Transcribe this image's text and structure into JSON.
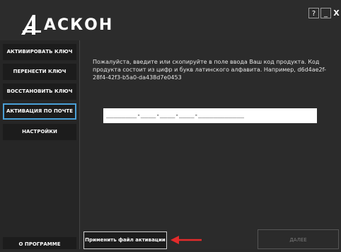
{
  "header": {
    "logo_text": "АСКОН",
    "help_label": "?",
    "minimize_label": "_",
    "close_label": "X"
  },
  "sidebar": {
    "items": [
      {
        "label": "АКТИВИРОВАТЬ КЛЮЧ"
      },
      {
        "label": "ПЕРЕНЕСТИ КЛЮЧ"
      },
      {
        "label": "ВОССТАНОВИТЬ КЛЮЧ"
      },
      {
        "label": "АКТИВАЦИЯ ПО ПОЧТЕ"
      },
      {
        "label": "НАСТРОЙКИ"
      }
    ],
    "about_label": "О ПРОГРАММЕ"
  },
  "main": {
    "description": "Пожалуйста, введите или скопируйте в поле ввода Ваш код продукта. Код продукта состоит из цифр и букв латинского алфавита. Например, d6d4ae2f-28f4-42f3-b5a0-da438d7e0453",
    "product_code_mask": "________-____-____-____-____________",
    "apply_button_label": "Применить файл активации",
    "next_button_label": "ДАЛЕЕ"
  },
  "colors": {
    "accent": "#4a9fd6",
    "arrow": "#e32b2b"
  }
}
